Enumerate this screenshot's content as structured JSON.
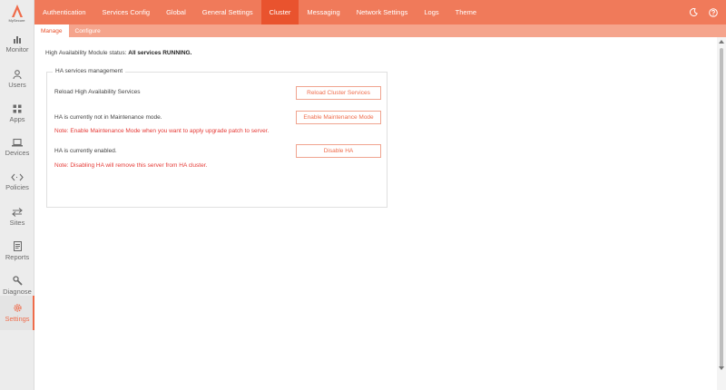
{
  "brand": {
    "name": "MySecure",
    "color": "#ef6c4b"
  },
  "sidebar": {
    "items": [
      {
        "label": "Monitor",
        "icon": "bar-chart-icon"
      },
      {
        "label": "Users",
        "icon": "user-icon"
      },
      {
        "label": "Apps",
        "icon": "apps-icon"
      },
      {
        "label": "Devices",
        "icon": "laptop-icon"
      },
      {
        "label": "Policies",
        "icon": "code-arrows-icon"
      },
      {
        "label": "Sites",
        "icon": "swap-arrows-icon"
      },
      {
        "label": "Reports",
        "icon": "report-icon"
      },
      {
        "label": "Diagnose",
        "icon": "wrench-icon"
      },
      {
        "label": "Settings",
        "icon": "gear-icon",
        "active": true
      }
    ]
  },
  "topnav": {
    "tabs": [
      {
        "label": "Authentication"
      },
      {
        "label": "Services Config"
      },
      {
        "label": "Global"
      },
      {
        "label": "General Settings"
      },
      {
        "label": "Cluster",
        "active": true
      },
      {
        "label": "Messaging"
      },
      {
        "label": "Network Settings"
      },
      {
        "label": "Logs"
      },
      {
        "label": "Theme"
      }
    ],
    "icons": [
      "moon-icon",
      "help-icon"
    ]
  },
  "subnav": {
    "tabs": [
      {
        "label": "Manage",
        "active": true
      },
      {
        "label": "Configure"
      }
    ]
  },
  "content": {
    "status_prefix": "High Availability Module status: ",
    "status_value": "All services RUNNING.",
    "fieldset_title": "HA services management",
    "rows": [
      {
        "text": "Reload High Availability Services",
        "button": "Reload Cluster Services",
        "note": ""
      },
      {
        "text": "HA is currently not in Maintenance mode.",
        "button": "Enable Maintenance Mode",
        "note": "Note: Enable Maintenance Mode when you want to apply upgrade patch to server."
      },
      {
        "text": "HA is currently enabled.",
        "button": "Disable HA",
        "note": "Note: Disabling HA will remove this server from HA cluster."
      }
    ]
  }
}
